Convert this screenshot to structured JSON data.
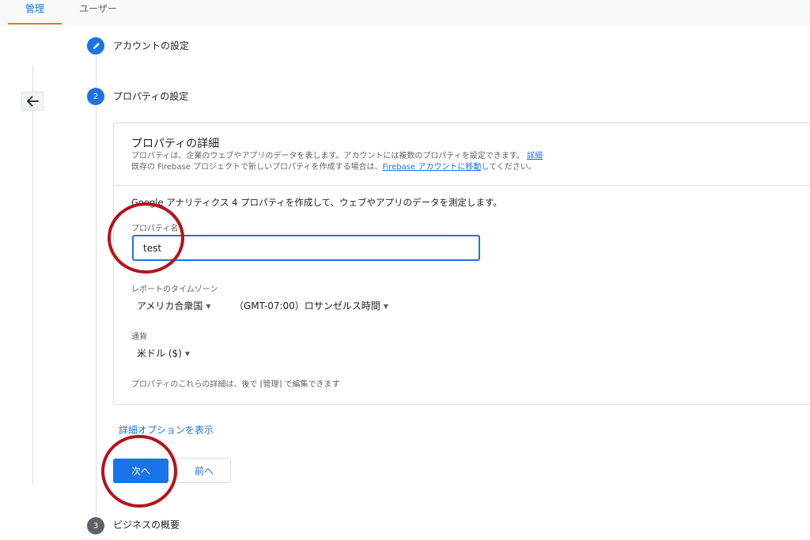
{
  "tabs": [
    {
      "label": "管理",
      "active": true
    },
    {
      "label": "ユーザー",
      "active": false
    }
  ],
  "steps": [
    {
      "number": "1",
      "label": "アカウントの設定",
      "status": "completed",
      "icon": "pencil-icon"
    },
    {
      "number": "2",
      "label": "プロパティの設定",
      "status": "current"
    },
    {
      "number": "3",
      "label": "ビジネスの概要",
      "status": "upcoming"
    }
  ],
  "card": {
    "title": "プロパティの詳細",
    "desc_line1": "プロパティは、企業のウェブやアプリのデータを表します。アカウントには複数のプロパティを設定できます。",
    "desc_line1_link": "詳細",
    "desc_line2_prefix": "既存の Firebase プロジェクトで新しいプロパティを作成する場合は、",
    "desc_line2_link": "Firebase アカウントに移動",
    "desc_line2_suffix": "してください。",
    "ga4_text": "Google アナリティクス 4 プロパティを作成して、ウェブやアプリのデータを測定します。",
    "property_name_label": "プロパティ名",
    "property_name_value": "test",
    "timezone_label": "レポートのタイムゾーン",
    "timezone_country": "アメリカ合衆国",
    "timezone_zone": "（GMT-07:00）ロサンゼルス時間",
    "currency_label": "通貨",
    "currency_value": "米ドル ($)",
    "edit_note": "プロパティのこれらの詳細は、後で [管理] で編集できます"
  },
  "advanced_options_link": "詳細オプションを表示",
  "buttons": {
    "next": "次へ",
    "prev": "前へ"
  },
  "colors": {
    "accent": "#1a73e8",
    "tab_underline": "#e8710a",
    "annotation": "#b5121b",
    "step_upcoming": "#5f6368"
  }
}
